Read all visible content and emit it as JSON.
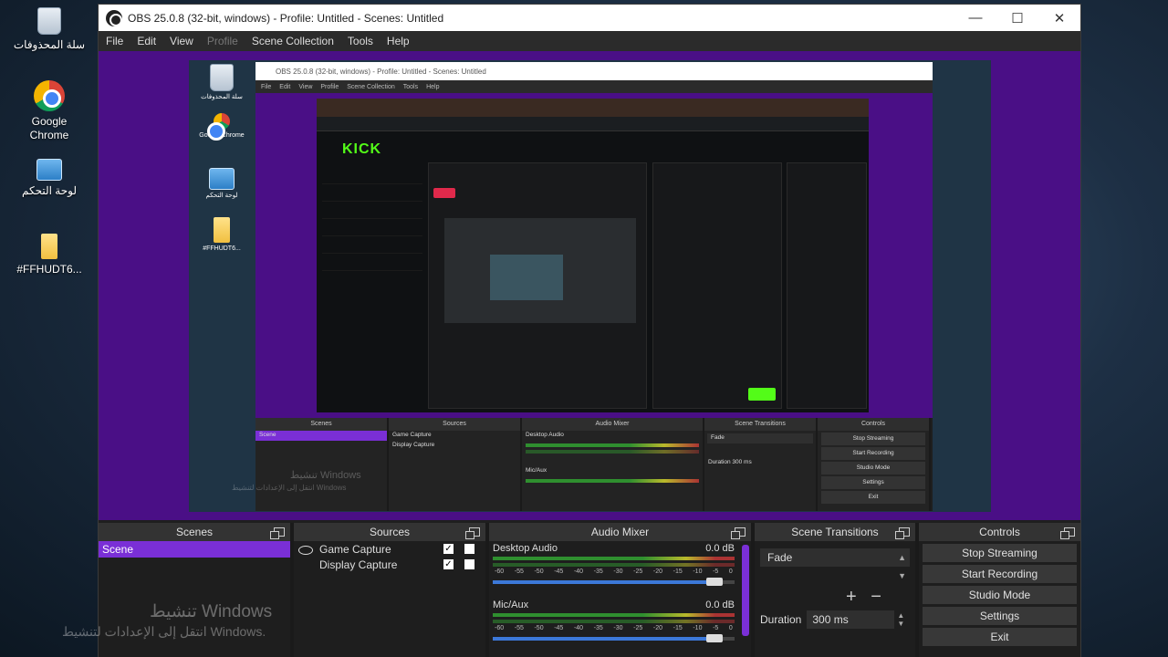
{
  "desktop": {
    "icons": [
      {
        "label": "سلة المحذوفات",
        "icon": "recycle-bin-icon"
      },
      {
        "label": "Google Chrome",
        "icon": "chrome-icon"
      },
      {
        "label": "لوحة التحكم",
        "icon": "control-panel-icon"
      },
      {
        "label": "#FFHUDT6...",
        "icon": "folder-icon"
      }
    ],
    "nested_icons": [
      {
        "label": "سلة المحذوفات"
      },
      {
        "label": "Google Chrome"
      },
      {
        "label": "لوحة التحكم"
      },
      {
        "label": "#FFHUDT6..."
      }
    ]
  },
  "window": {
    "title": "OBS 25.0.8 (32-bit, windows) - Profile: Untitled - Scenes: Untitled",
    "minimize": "—",
    "maximize": "☐",
    "close": "✕"
  },
  "menu": [
    "File",
    "Edit",
    "View",
    "Profile",
    "Scene Collection",
    "Tools",
    "Help"
  ],
  "nested": {
    "title": "OBS 25.0.8 (32-bit, windows) - Profile: Untitled - Scenes: Untitled",
    "menu": [
      "File",
      "Edit",
      "View",
      "Profile",
      "Scene Collection",
      "Tools",
      "Help"
    ],
    "kick_logo": "KICK",
    "docks": {
      "scenes": "Scenes",
      "sources": "Sources",
      "mixer": "Audio Mixer",
      "transitions": "Scene Transitions",
      "controls": "Controls",
      "scene": "Scene",
      "src1": "Game Capture",
      "src2": "Display Capture",
      "ch1": "Desktop Audio",
      "ch2": "Mic/Aux",
      "db": "0.0 dB",
      "fade": "Fade",
      "duration": "Duration",
      "duration_val": "300 ms",
      "buttons": [
        "Stop Streaming",
        "Start Recording",
        "Studio Mode",
        "Settings",
        "Exit"
      ]
    },
    "watermark_1": "تنشيط Windows",
    "watermark_2": "انتقل إلى الإعدادات لتنشيط Windows"
  },
  "scenes": {
    "header": "Scenes",
    "items": [
      "Scene"
    ]
  },
  "sources": {
    "header": "Sources",
    "items": [
      {
        "label": "Game Capture",
        "visible": true,
        "locked": false
      },
      {
        "label": "Display Capture",
        "visible": true,
        "locked": false
      }
    ]
  },
  "mixer": {
    "header": "Audio Mixer",
    "channels": [
      {
        "name": "Desktop Audio",
        "db": "0.0 dB",
        "volume": 0.95
      },
      {
        "name": "Mic/Aux",
        "db": "0.0 dB",
        "volume": 0.95
      }
    ],
    "ticks": [
      "-60",
      "-55",
      "-50",
      "-45",
      "-40",
      "-35",
      "-30",
      "-25",
      "-20",
      "-15",
      "-10",
      "-5",
      "0"
    ]
  },
  "transitions": {
    "header": "Scene Transitions",
    "selected": "Fade",
    "plus": "+",
    "minus": "−",
    "duration_label": "Duration",
    "duration_value": "300 ms"
  },
  "controls": {
    "header": "Controls",
    "buttons": [
      "Stop Streaming",
      "Start Recording",
      "Studio Mode",
      "Settings",
      "Exit"
    ]
  },
  "watermark": {
    "line1": "تنشيط Windows",
    "line2": "انتقل إلى الإعدادات لتنشيط Windows."
  },
  "colors": {
    "accent": "#7a2fd6",
    "canvas": "#4a0f86",
    "kick_green": "#53fc18"
  }
}
